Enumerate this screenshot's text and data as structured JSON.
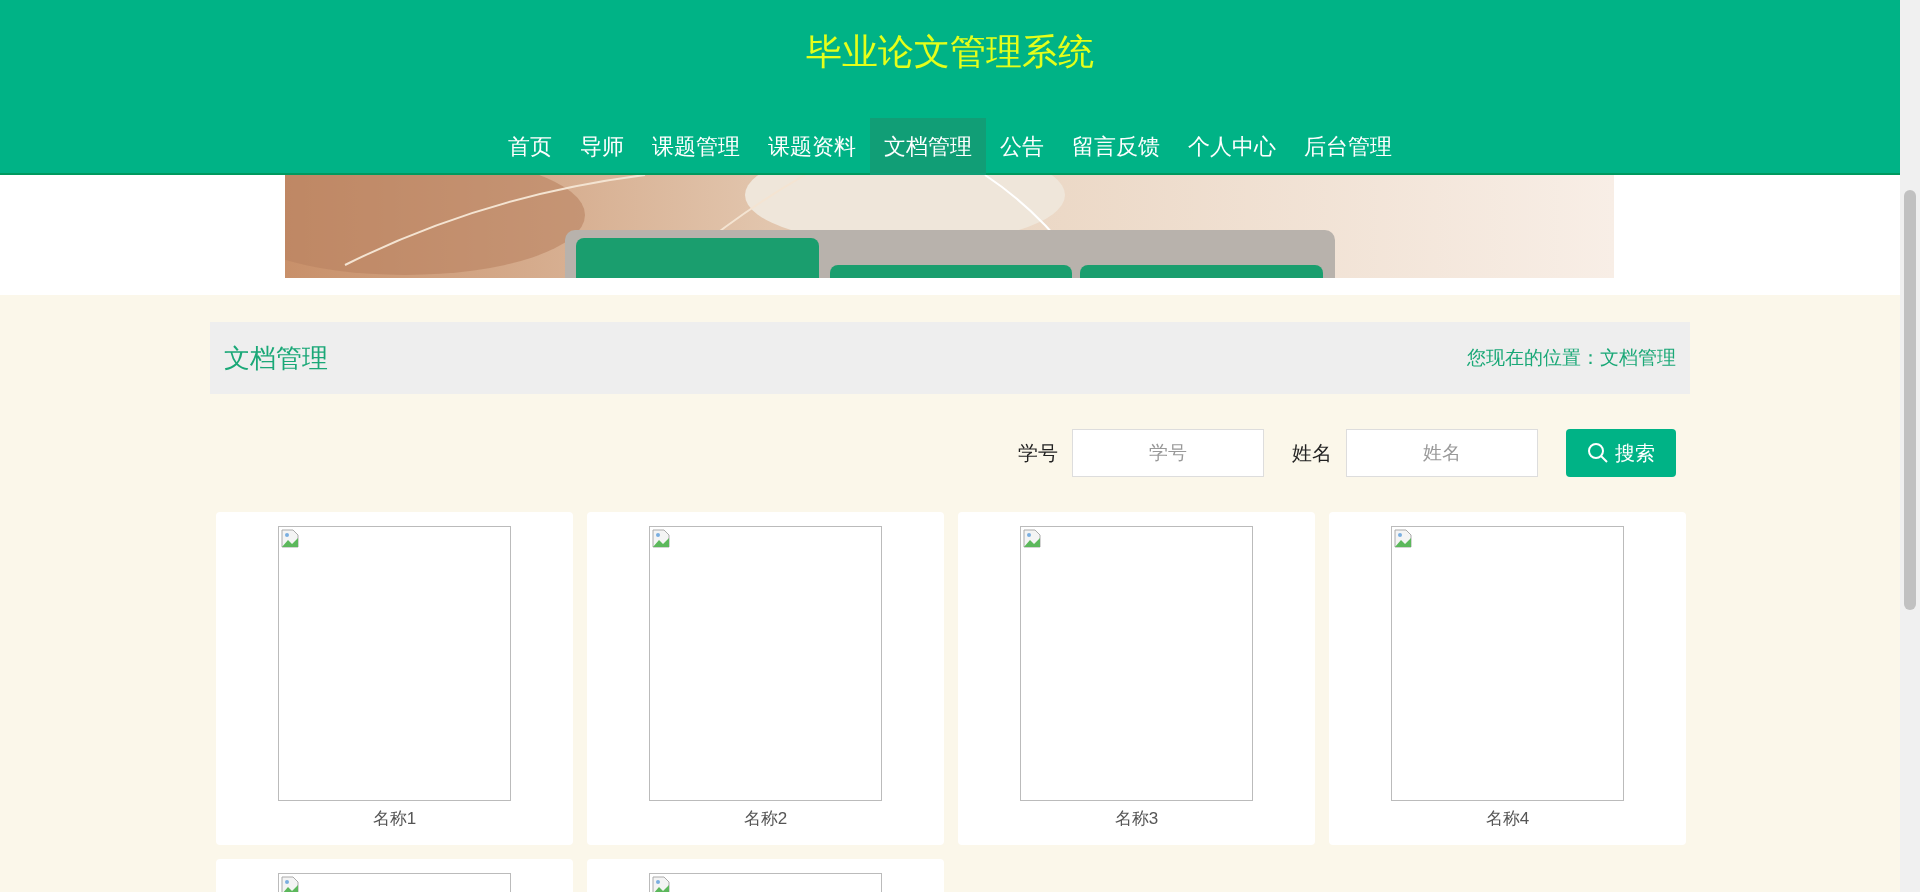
{
  "site_title": "毕业论文管理系统",
  "nav": [
    {
      "label": "首页",
      "selected": false
    },
    {
      "label": "导师",
      "selected": false
    },
    {
      "label": "课题管理",
      "selected": false
    },
    {
      "label": "课题资料",
      "selected": false
    },
    {
      "label": "文档管理",
      "selected": true
    },
    {
      "label": "公告",
      "selected": false
    },
    {
      "label": "留言反馈",
      "selected": false
    },
    {
      "label": "个人中心",
      "selected": false
    },
    {
      "label": "后台管理",
      "selected": false
    }
  ],
  "section": {
    "title": "文档管理",
    "breadcrumb": "您现在的位置：文档管理"
  },
  "search": {
    "fields": [
      {
        "label": "学号",
        "placeholder": "学号"
      },
      {
        "label": "姓名",
        "placeholder": "姓名"
      }
    ],
    "button": "搜索"
  },
  "documents": [
    {
      "kind": "named",
      "name": "名称1"
    },
    {
      "kind": "named",
      "name": "名称2"
    },
    {
      "kind": "named",
      "name": "名称3"
    },
    {
      "kind": "named",
      "name": "名称4"
    },
    {
      "kind": "image_only"
    },
    {
      "kind": "image_only"
    }
  ]
}
